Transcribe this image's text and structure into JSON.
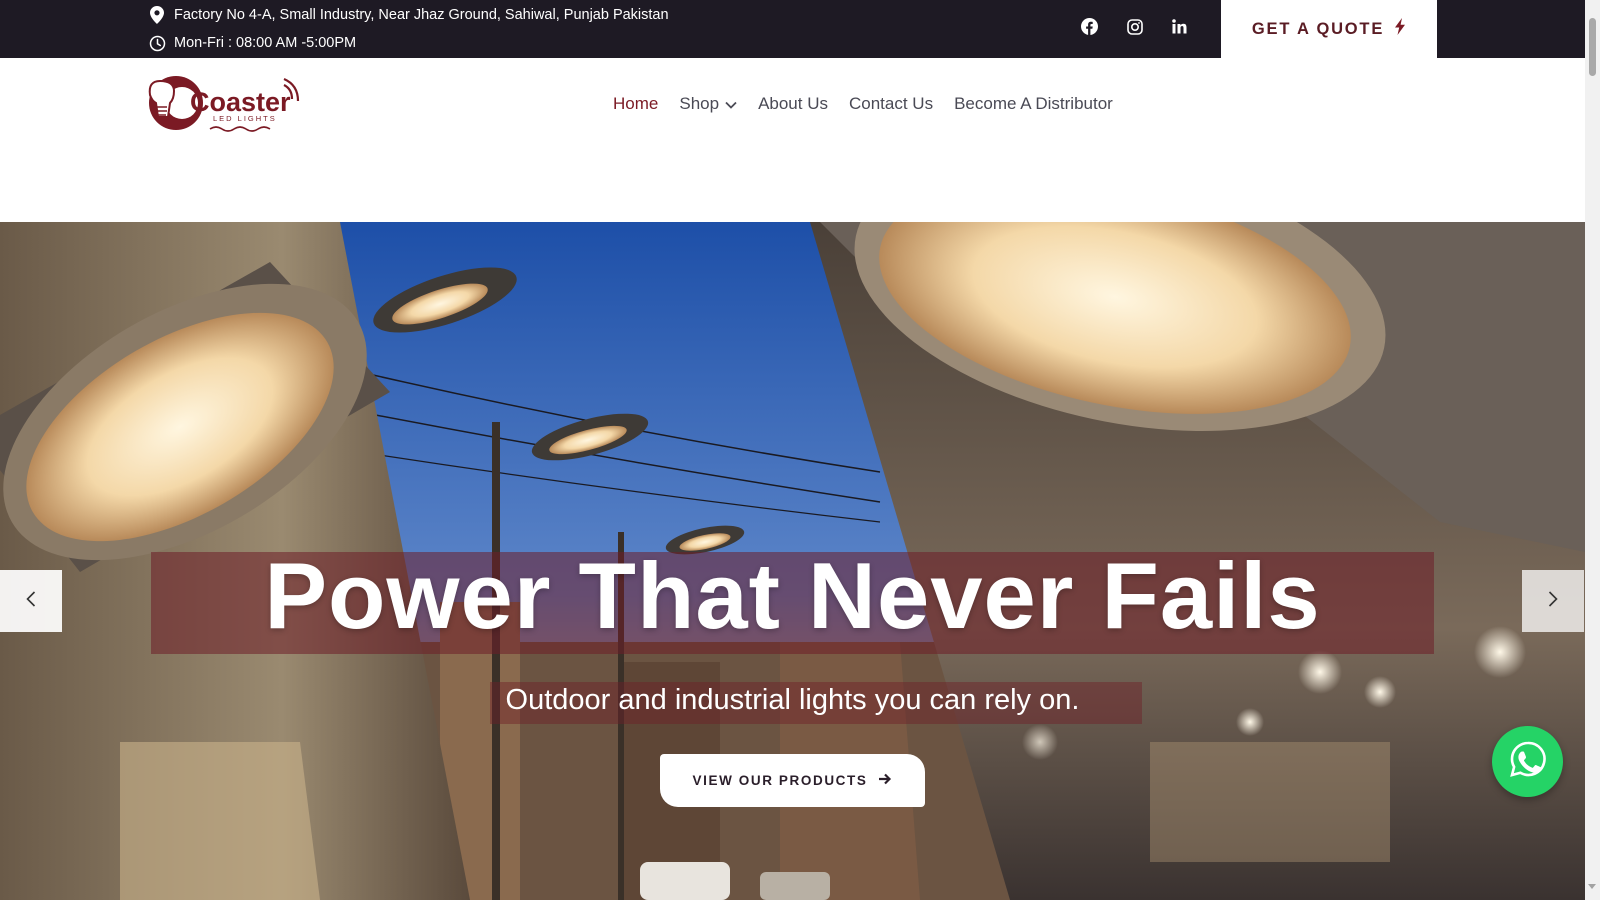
{
  "topbar": {
    "address": "Factory No 4-A, Small Industry, Near Jhaz Ground, Sahiwal, Punjab Pakistan",
    "hours": "Mon-Fri : 08:00 AM -5:00PM",
    "address_icon": "location-pin-icon",
    "hours_icon": "clock-icon",
    "socials": [
      "facebook-icon",
      "instagram-icon",
      "linkedin-icon"
    ],
    "quote_button": "GET A QUOTE",
    "quote_icon": "lightning-icon"
  },
  "header": {
    "logo_text": "Coaster",
    "logo_subtext": "LED LIGHTS",
    "nav": {
      "home": "Home",
      "shop": "Shop",
      "about": "About Us",
      "contact": "Contact Us",
      "distributor": "Become A Distributor"
    }
  },
  "hero": {
    "headline": "Power That Never Fails",
    "subtitle": "Outdoor and industrial lights you can rely on.",
    "cta_label": "VIEW OUR PRODUCTS",
    "cta_icon": "arrow-right-icon",
    "prev_icon": "chevron-left-icon",
    "next_icon": "chevron-right-icon",
    "whatsapp_icon": "whatsapp-icon"
  },
  "colors": {
    "topbar_bg": "#1e1a24",
    "brand": "#7b1a24",
    "nav_text": "#4a4a55",
    "whatsapp": "#25d366"
  }
}
